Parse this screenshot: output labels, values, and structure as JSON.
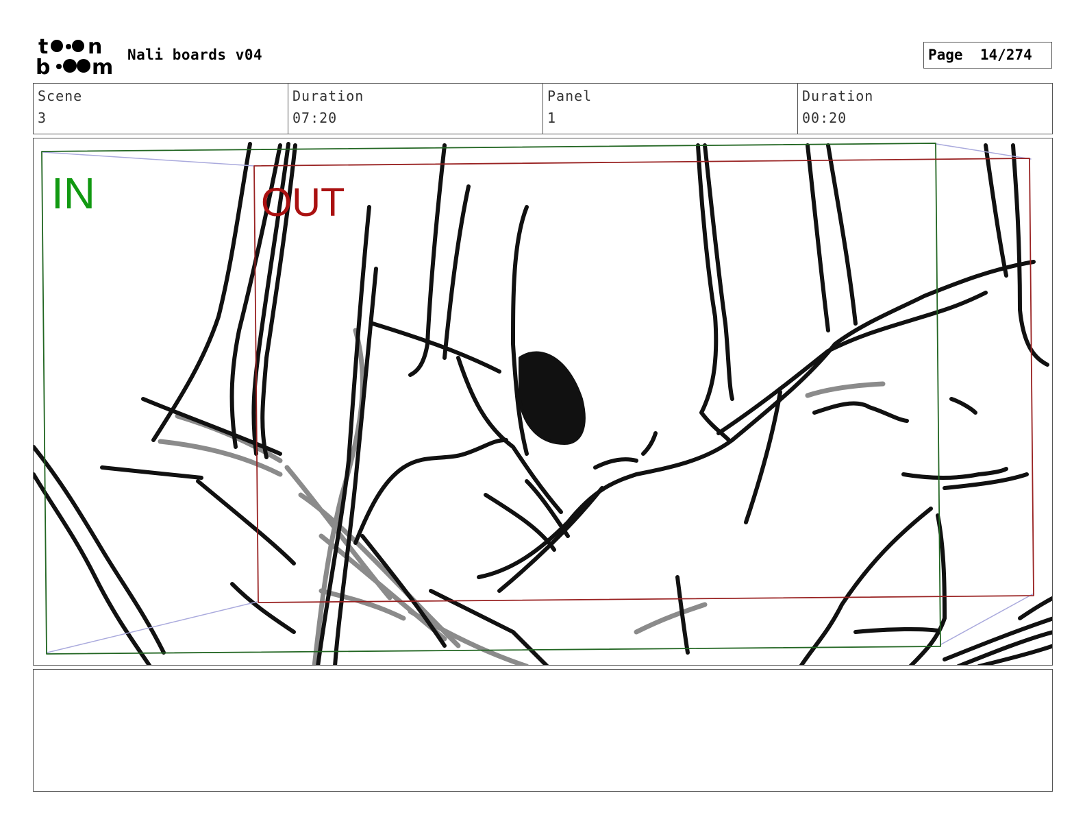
{
  "header": {
    "logo_text": "toonboom",
    "title": "Nali boards v04",
    "page_label": "Page",
    "page_value": "14/274"
  },
  "info": {
    "scene_label": "Scene",
    "scene_value": "3",
    "scene_duration_label": "Duration",
    "scene_duration_value": "07:20",
    "panel_label": "Panel",
    "panel_value": "1",
    "panel_duration_label": "Duration",
    "panel_duration_value": "00:20"
  },
  "panel": {
    "in_label": "IN",
    "out_label": "OUT",
    "in_color": "#119911",
    "out_color": "#aa1111"
  },
  "notes": {
    "text": ""
  }
}
